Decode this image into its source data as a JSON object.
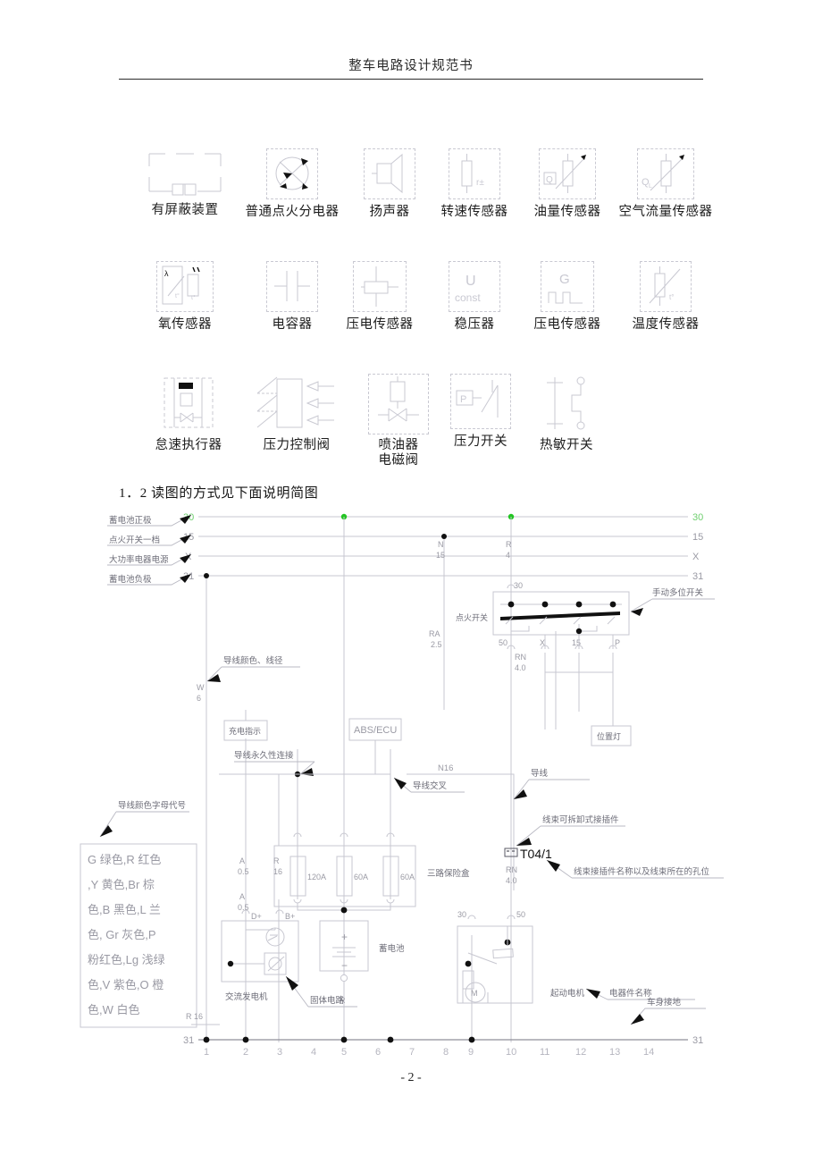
{
  "header": {
    "title": "整车电路设计规范书"
  },
  "section": {
    "heading": "1．2 读图的方式见下面说明简图"
  },
  "footer": {
    "page_number": "- 2 -"
  },
  "symbols": {
    "row1": [
      {
        "label": "有屏蔽装置",
        "icon": "shielded-device-icon"
      },
      {
        "label": "普通点火分电器",
        "icon": "distributor-icon"
      },
      {
        "label": "扬声器",
        "icon": "loudspeaker-icon"
      },
      {
        "label": "转速传感器",
        "icon": "speed-sensor-icon",
        "glyph": "r±"
      },
      {
        "label": "油量传感器",
        "icon": "fuel-level-sensor-icon",
        "glyph": "Q"
      },
      {
        "label": "空气流量传感器",
        "icon": "air-flow-sensor-icon",
        "glyph": "QL"
      }
    ],
    "row2": [
      {
        "label": "氧传感器",
        "icon": "oxygen-sensor-icon",
        "glyph": "λ"
      },
      {
        "label": "电容器",
        "icon": "capacitor-icon"
      },
      {
        "label": "压电传感器",
        "icon": "piezo-sensor-icon"
      },
      {
        "label": "稳压器",
        "icon": "voltage-regulator-icon",
        "glyph": "U const"
      },
      {
        "label": "压电传感器",
        "icon": "piezo-pulse-sensor-icon",
        "glyph": "G"
      },
      {
        "label": "温度传感器",
        "icon": "temperature-sensor-icon",
        "glyph": "t°"
      }
    ],
    "row3": [
      {
        "label": "怠速执行器",
        "icon": "idle-actuator-icon"
      },
      {
        "label": "压力控制阀",
        "icon": "pressure-control-valve-icon"
      },
      {
        "label": "喷油器\n电磁阀",
        "icon": "injector-solenoid-valve-icon"
      },
      {
        "label": "压力开关",
        "icon": "pressure-switch-icon",
        "glyph": "P"
      },
      {
        "label": "热敏开关",
        "icon": "thermal-switch-icon"
      }
    ]
  },
  "circuit": {
    "bus_labels_left": [
      "30",
      "15",
      "X",
      "31"
    ],
    "bus_labels_right": [
      "30",
      "15",
      "X",
      "31"
    ],
    "bus_annotations": [
      "蓄电池正极",
      "点火开关一档",
      "大功率电器电源",
      "蓄电池负极"
    ],
    "annotations": {
      "wire_color_gauge": "导线颜色、线径",
      "wire_permanent_connection": "导线永久性连接",
      "wire_cross": "导线交叉",
      "wire": "导线",
      "wire_color_code": "导线颜色字母代号",
      "manual_multi_switch": "手动多位开关",
      "detachable_connector": "线束可拆卸式接插件",
      "connector_name_hole": "线束接插件名称以及线束所在的孔位",
      "component_name": "电器件名称",
      "body_ground": "车身接地"
    },
    "components": {
      "ignition_switch": "点火开关",
      "charge_indicator": "充电指示",
      "abs_ecu": "ABS/ECU",
      "position_lamp": "位置灯",
      "fuse_box": "三路保险盒",
      "battery": "蓄电池",
      "alternator": "交流发电机",
      "solid_circuit": "固体电路",
      "starter_motor": "起动电机",
      "connector_tag": "T04/1"
    },
    "fuses": [
      "120A",
      "60A",
      "60A"
    ],
    "switch_terminals": [
      "30",
      "50",
      "X",
      "15",
      "P"
    ],
    "wire_labels": [
      {
        "name": "W",
        "size": "6"
      },
      {
        "name": "N",
        "size": "15"
      },
      {
        "name": "R",
        "size": "4"
      },
      {
        "name": "RA",
        "size": "2.5"
      },
      {
        "name": "RN",
        "size": "4.0"
      },
      {
        "name": "A",
        "size": "0.5"
      },
      {
        "name": "A",
        "size": "0.5"
      },
      {
        "name": "R",
        "size": "16"
      },
      {
        "name": "RN",
        "size": "4.0"
      },
      {
        "name": "N16",
        "size": ""
      },
      {
        "name": "R 16",
        "size": ""
      },
      {
        "name": "R",
        "size": ""
      }
    ],
    "terminal_marks": [
      "D+",
      "B+",
      "30",
      "50"
    ],
    "color_legend": "G 绿色,R 红色,Y 黄色,Br 棕色,B 黑色,L 兰色, Gr 灰色,P 粉红色,Lg 浅绿色,V 紫色,O 橙色,W 白色",
    "color_legend_lines": [
      "G 绿色,R 红色",
      ",Y 黄色,Br 棕",
      "色,B 黑色,L 兰",
      "色, Gr 灰色,P",
      "粉红色,Lg 浅绿",
      "色,V 紫色,O 橙",
      "色,W 白色"
    ],
    "column_numbers": [
      "1",
      "2",
      "3",
      "4",
      "5",
      "6",
      "7",
      "8",
      "9",
      "10",
      "11",
      "12",
      "13",
      "14"
    ],
    "colors": {
      "wire": "#c7c7d0",
      "node": "#111111",
      "green_node": "#22c522",
      "text": "#8c8c96"
    }
  }
}
